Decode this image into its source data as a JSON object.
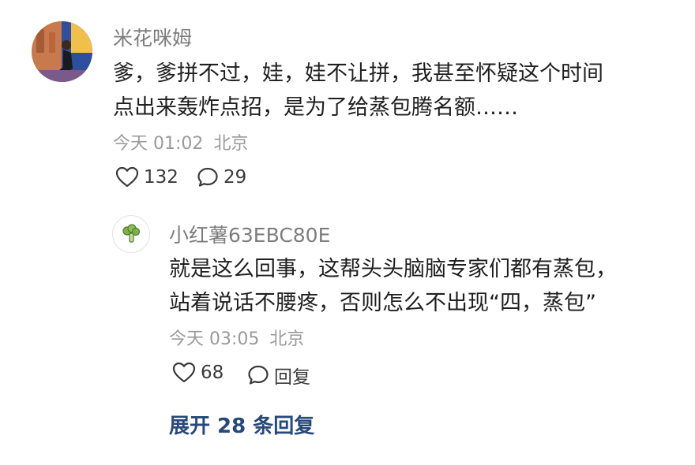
{
  "comment": {
    "username": "米花咪姆",
    "text_line1": "爹，爹拼不过，娃，娃不让拼，我甚至怀疑这个时间",
    "text_line2": "点出来轰炸点招，是为了给蒸包腾名额……",
    "time": "今天 01:02",
    "location": "北京",
    "like_count": "132",
    "reply_count": "29",
    "avatar_icon": "profile-photo"
  },
  "reply": {
    "username": "小红薯63EBC80E",
    "text_line1": "就是这么回事，这帮头头脑脑专家们都有蒸包，",
    "text_line2": "站着说话不腰疼，否则怎么不出现“四，蒸包”",
    "time": "今天 03:05",
    "location": "北京",
    "like_count": "68",
    "reply_label": "回复",
    "avatar_icon": "broccoli-icon"
  },
  "expand": {
    "label": "展开 28 条回复"
  },
  "colors": {
    "link": "#27487a",
    "username": "#7d7d7d",
    "meta": "#9a9a9a",
    "text": "#1f1f1f"
  }
}
